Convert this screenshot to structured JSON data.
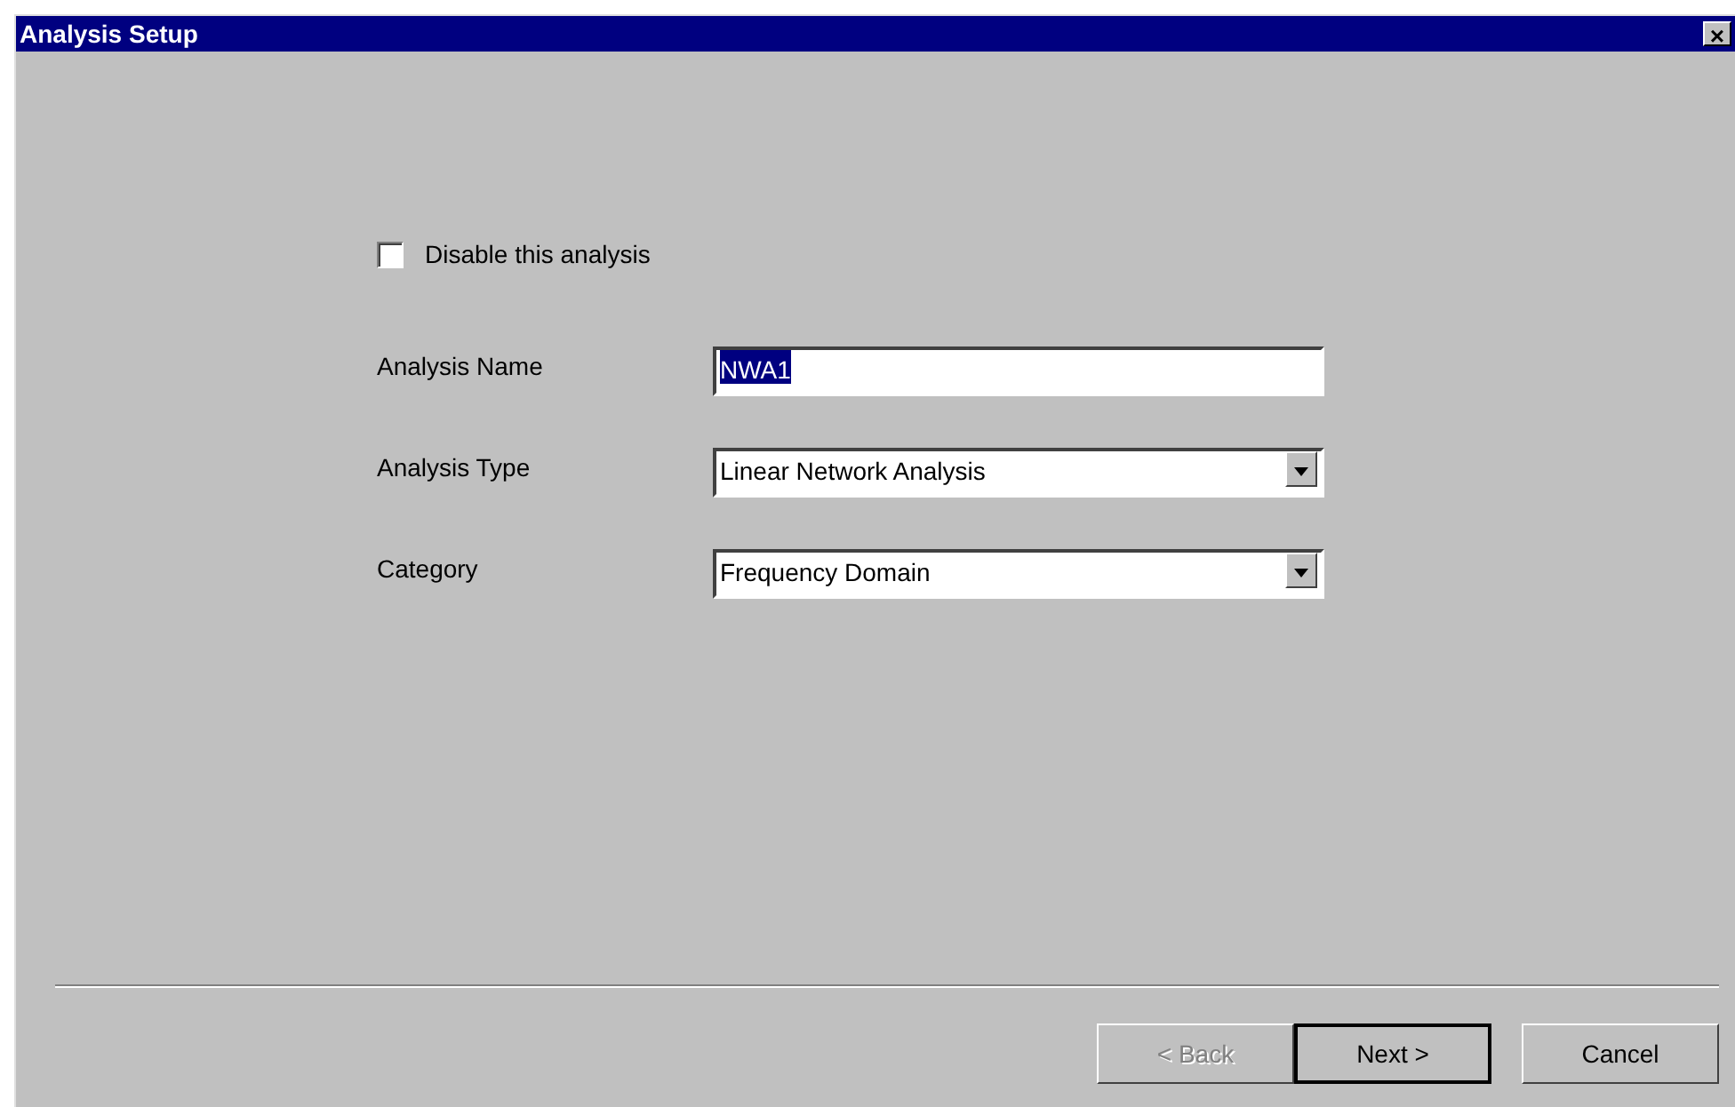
{
  "window": {
    "title": "Analysis Setup",
    "close": "×"
  },
  "disable_checkbox": {
    "label": "Disable this analysis",
    "checked": false
  },
  "fields": [
    {
      "kind": "text",
      "label": "Analysis Name",
      "value": "NWA1",
      "selected": true
    },
    {
      "kind": "dropdown",
      "label": "Analysis Type",
      "value": "Linear Network Analysis"
    },
    {
      "kind": "dropdown",
      "label": "Category",
      "value": "Frequency Domain"
    }
  ],
  "buttons": [
    {
      "label": "< Back",
      "disabled": true,
      "default": false
    },
    {
      "label": "Next >",
      "disabled": false,
      "default": true
    },
    {
      "label": "Cancel",
      "disabled": false,
      "default": false
    }
  ]
}
